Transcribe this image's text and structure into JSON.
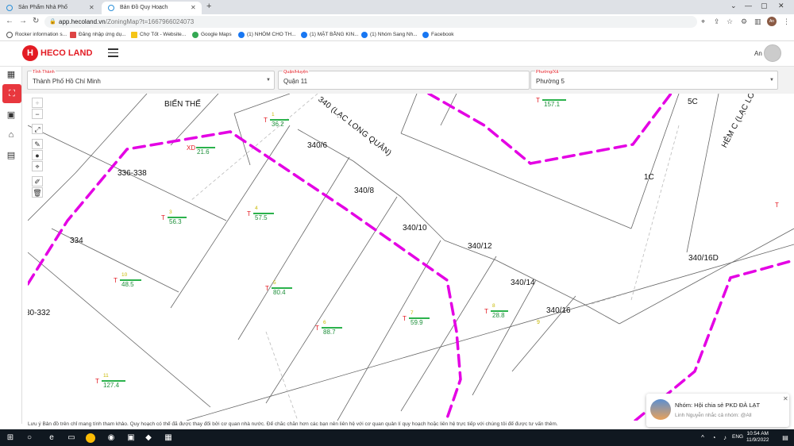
{
  "browser": {
    "tabs": [
      {
        "title": "Sản Phẩm Nhà Phố"
      },
      {
        "title": "Bản Đồ Quy Hoạch"
      }
    ],
    "url_host": "app.hecoland.vn",
    "url_path": "/ZoningMap?t=1667966024073",
    "profile_initials": "An",
    "bookmarks": [
      {
        "label": "Rocker information s..."
      },
      {
        "label": "Đăng nhập ứng dụ..."
      },
      {
        "label": "Chợ Tốt - Website..."
      },
      {
        "label": "Google Maps"
      },
      {
        "label": "(1) NHÓM CHO TH..."
      },
      {
        "label": "(1) MẶT BẰNG KIN..."
      },
      {
        "label": "(1) Nhóm Sang Nh..."
      },
      {
        "label": "Facebook"
      }
    ]
  },
  "app": {
    "logo_text": "HECO LAND",
    "logo_letter": "H",
    "user_name": "An",
    "brand_color": "#e31b23"
  },
  "sidebar": {
    "items": [
      {
        "icon": "layers-icon"
      },
      {
        "icon": "map-icon"
      },
      {
        "icon": "package-icon"
      },
      {
        "icon": "house-gear-icon"
      },
      {
        "icon": "document-icon"
      }
    ]
  },
  "filters": [
    {
      "label": "Tỉnh Thành",
      "value": "Thành Phố Hồ Chí Minh"
    },
    {
      "label": "Quận/Huyện",
      "value": "Quận 11"
    },
    {
      "label": "Phường/Xã",
      "value": "Phường 5"
    }
  ],
  "map": {
    "street_labels": [
      "BIẾN THẾ",
      "340 (LẠC LONG QUÂN)",
      "HẺM C (LẠC LO"
    ],
    "parcel_labels": [
      "340/6",
      "340/8",
      "340/10",
      "340/12",
      "340/14",
      "340/16",
      "340/16D",
      "336-338",
      "334",
      "30-332",
      "5C",
      "1C"
    ],
    "plots": [
      {
        "type": "T",
        "code": "1",
        "area": "36.2"
      },
      {
        "type": "XD",
        "code": "",
        "area": "21.6"
      },
      {
        "type": "T",
        "code": "3",
        "area": "56.3"
      },
      {
        "type": "T",
        "code": "4",
        "area": "57.5"
      },
      {
        "type": "T",
        "code": "10",
        "area": "48.5"
      },
      {
        "type": "T",
        "code": "5",
        "area": "80.4"
      },
      {
        "type": "T",
        "code": "6",
        "area": "88.7"
      },
      {
        "type": "T",
        "code": "7",
        "area": "59.9"
      },
      {
        "type": "T",
        "code": "8",
        "area": "28.8"
      },
      {
        "type": "T",
        "code": "11",
        "area": "127.4"
      },
      {
        "type": "T",
        "code": "",
        "area": "157.1"
      }
    ],
    "extra_labels": [
      "T",
      "9"
    ],
    "controls": [
      "+",
      "−",
      "⤢",
      "✎",
      "●",
      "⌖",
      "✐",
      "🗑"
    ],
    "boundary_color": "#e400e4"
  },
  "disclaimer": "Lưu ý Bản đồ trên chỉ mang tính tham khảo. Quy hoạch có thể đã được thay đổi bởi cơ quan nhà nước. Để chắc chắn hơn các bạn nên liên hệ với cơ quan quản lí quy hoạch hoặc liên hệ trực tiếp với chúng tôi để được tư vấn thêm.",
  "notification": {
    "title": "Nhóm: Hội chia sẻ PKD ĐÀ LẠT",
    "subtitle": "Linh Nguyễn nhắc cả nhóm: @All"
  },
  "taskbar": {
    "lang": "ENG",
    "time": "10:54 AM",
    "date": "11/9/2022"
  }
}
